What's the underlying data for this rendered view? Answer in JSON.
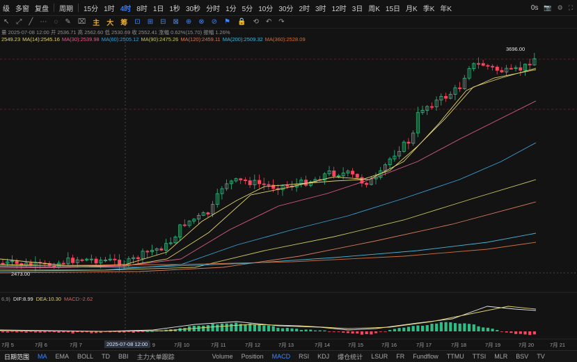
{
  "topbar": {
    "items": [
      "级",
      "多窗",
      "复盘",
      "周期",
      "15分",
      "1时",
      "4时",
      "8时",
      "1日",
      "1秒",
      "30秒",
      "分时",
      "1分",
      "5分",
      "10分",
      "30分",
      "2时",
      "3时",
      "12时",
      "3日",
      "周K",
      "15日",
      "月K",
      "季K",
      "年K"
    ],
    "active": "4时",
    "right_label": "0s"
  },
  "toolbar": {
    "items": [
      "↖",
      "⤢",
      "╱",
      "⋯",
      "◌",
      "✎",
      "⌧",
      "主",
      "大",
      "筹",
      "⊡",
      "⊞",
      "⊟",
      "⊠",
      "⊕",
      "⊗",
      "⊘",
      "⚑",
      "🔒",
      "⟲",
      "↶",
      "↷"
    ],
    "hot": [
      "主",
      "大",
      "筹"
    ]
  },
  "ohlc_text": "量 2025-07-08 12:00  开 2536.71  高 2562.60  低 2530.69  收 2552.41  涨幅 0.62%(15.70)  振幅 1.26%",
  "ma_legend": [
    {
      "text": "2549.23",
      "color": "#e3d36b"
    },
    {
      "text": "MA(14):2545.16",
      "color": "#e3d36b"
    },
    {
      "text": "MA(30):2539.98",
      "color": "#e05d8c"
    },
    {
      "text": "MA(60):2505.12",
      "color": "#3aa0d8"
    },
    {
      "text": "MA(90):2475.26",
      "color": "#c9c45a"
    },
    {
      "text": "MA(120):2459.11",
      "color": "#d67b5a"
    },
    {
      "text": "MA(200):2509.32",
      "color": "#46b4d6"
    },
    {
      "text": "MA(360):2528.09",
      "color": "#d0703a"
    }
  ],
  "macd_legend": [
    {
      "text": "6,9)",
      "color": "#8e8e8e"
    },
    {
      "text": "DIF:8.99",
      "color": "#e6e6e6"
    },
    {
      "text": "DEA:10.30",
      "color": "#e3d36b"
    },
    {
      "text": "MACD:-2.62",
      "color": "#e05d5d"
    }
  ],
  "price_high_label": "3696.00",
  "price_low_label": "2473.00",
  "cursor_date": "2025-07-08 12:00",
  "x_labels": [
    "7月 5",
    "7月 6",
    "7月 7",
    "7月 9",
    "7月 10",
    "7月 11",
    "7月 12",
    "7月 13",
    "7月 14",
    "7月 15",
    "7月 16",
    "7月 17",
    "7月 18",
    "7月 19",
    "7月 20",
    "7月 21"
  ],
  "bottombar": {
    "items": [
      "日期范围",
      "MA",
      "EMA",
      "BOLL",
      "TD",
      "BBI",
      "主力大单跟踪",
      "Volume",
      "Position",
      "MACD",
      "RSI",
      "KDJ",
      "爆仓统计",
      "LSUR",
      "FR",
      "Fundflow",
      "TTMU",
      "TTSI",
      "MLR",
      "BSV",
      "TV"
    ],
    "active": [
      "MA",
      "MACD"
    ]
  },
  "colors": {
    "up": "#2ebd85",
    "down": "#f6465d",
    "bg": "#131313"
  },
  "chart_data": {
    "type": "candlestick",
    "price_range": [
      2460,
      3720
    ],
    "candles": [],
    "moving_averages": [
      "MA(14)",
      "MA(30)",
      "MA(60)",
      "MA(90)",
      "MA(120)",
      "MA(200)",
      "MA(360)"
    ],
    "indicator": "MACD"
  }
}
